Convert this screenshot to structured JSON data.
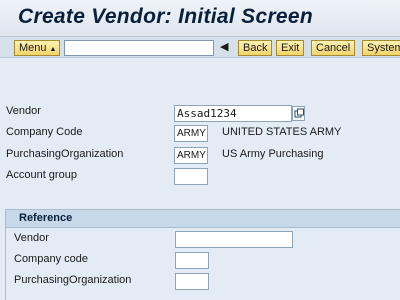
{
  "title": "Create Vendor:  Initial Screen",
  "toolbar": {
    "menu_label": "Menu",
    "command_value": "",
    "back_label": "Back",
    "exit_label": "Exit",
    "cancel_label": "Cancel",
    "system_label": "System"
  },
  "form": {
    "vendor_label": "Vendor",
    "vendor_value": "Assad1234",
    "company_code_label": "Company Code",
    "company_code_value": "ARMY",
    "company_code_desc": "UNITED STATES ARMY",
    "purch_org_label": "PurchasingOrganization",
    "purch_org_value": "ARMY",
    "purch_org_desc": "US Army Purchasing",
    "account_group_label": "Account group",
    "account_group_value": ""
  },
  "reference": {
    "header": "Reference",
    "vendor_label": "Vendor",
    "vendor_value": "",
    "company_code_label": "Company code",
    "company_code_value": "",
    "purch_org_label": "PurchasingOrganization",
    "purch_org_value": ""
  },
  "icons": {
    "menu_dropdown": "triangle-down-icon",
    "back_nav": "left-arrow-icon",
    "value_help": "value-help-icon"
  }
}
